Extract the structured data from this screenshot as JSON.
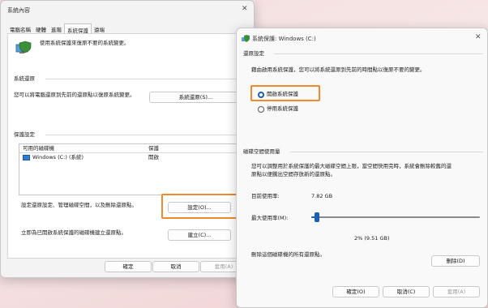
{
  "sysprop": {
    "title": "系統內容",
    "tabs": [
      "電腦名稱",
      "硬體",
      "進階",
      "系統保護",
      "遠端"
    ],
    "intro": "使用系統保護來復原不要的系統變更。",
    "restore_section": "系統還原",
    "restore_desc": "您可以將電腦還原到先前的還原點以復原系統變更。",
    "restore_btn": "系統還原(S)...",
    "settings_section": "保護設定",
    "list_header_drive": "可用的磁碟機",
    "list_header_protect": "保護",
    "drive_name": "Windows (C:) (系統)",
    "drive_status": "開啟",
    "config_desc": "設定還原設定、管理磁碟空間，以及刪除還原點。",
    "config_btn": "設定(O)...",
    "create_desc": "立即為已開啟系統保護的磁碟機建立還原點。",
    "create_btn": "建立(C)...",
    "ok": "確定",
    "cancel": "取消",
    "apply": "套用(A)"
  },
  "protect": {
    "title": "系統保護: Windows (C:)",
    "restore_settings": "還原設定",
    "restore_desc": "藉由啟用系統保護，您可以將系統還原到先前的時間點以復原不要的變更。",
    "on_label": "開啟系統保護",
    "off_label": "停用系統保護",
    "usage_section": "磁碟空間使用量",
    "usage_desc1": "您可以調整用於系統保護的最大磁碟空間上限，當空間快用完時，系統會刪除較舊的還",
    "usage_desc2": "原點以便騰出空間存放新的還原點。",
    "current_label": "目前使用率:",
    "current_value": "7.82 GB",
    "max_label": "最大使用率(M):",
    "slider_value": "2% (9.51 GB)",
    "slider_fraction": 0.02,
    "delete_desc": "刪除這個磁碟機的所有還原點。",
    "delete_btn": "刪除(D)",
    "ok": "確定(O)",
    "cancel": "取消(C)",
    "apply": "套用(A)"
  },
  "colors": {
    "highlight": "#f08a2c",
    "accent": "#1a5fb4"
  }
}
